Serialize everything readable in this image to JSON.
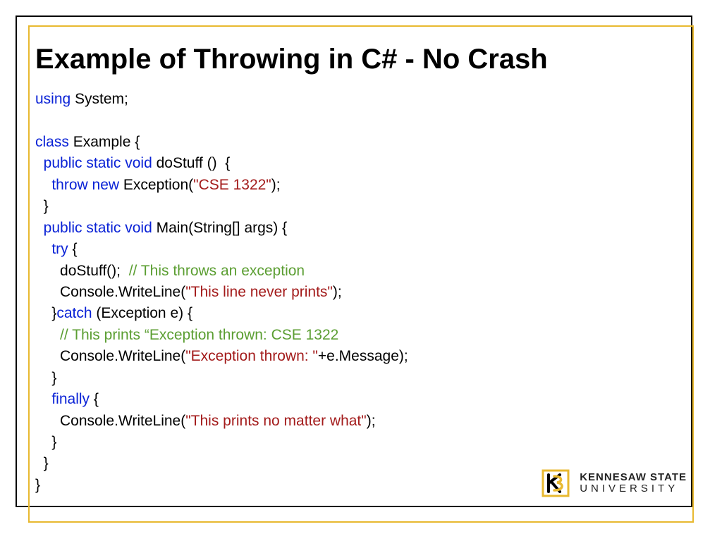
{
  "title": "Example of Throwing in C# - No Crash",
  "code": {
    "l1": {
      "kw1": "using",
      "t1": " System;"
    },
    "l2": {
      "kw1": "class",
      "t1": " Example {"
    },
    "l3": {
      "kw1": "public static void",
      "t1": " doStuff ()  {"
    },
    "l4": {
      "kw1": "throw new",
      "t1": " Exception(",
      "str1": "\"CSE 1322\"",
      "t2": ");"
    },
    "l5": {
      "t1": "}"
    },
    "l6": {
      "kw1": "public static void",
      "t1": " Main(String[] args) {"
    },
    "l7": {
      "kw1": "try",
      "t1": " {"
    },
    "l8": {
      "t1": "doStuff();  ",
      "cmt1": "// This throws an exception"
    },
    "l9": {
      "t1": "Console.WriteLine(",
      "str1": "\"This line never prints\"",
      "t2": ");"
    },
    "l10": {
      "t1": "}",
      "kw1": "catch",
      "t2": " (Exception e) {"
    },
    "l11": {
      "cmt1": "// This prints “Exception thrown: CSE 1322"
    },
    "l12": {
      "t1": "Console.WriteLine(",
      "str1": "\"Exception thrown: \"",
      "t2": "+e.Message);"
    },
    "l13": {
      "t1": "}"
    },
    "l14": {
      "kw1": "finally",
      "t1": " {"
    },
    "l15": {
      "t1": "Console.WriteLine(",
      "str1": "\"This prints no matter what\"",
      "t2": ");"
    },
    "l16": {
      "t1": "}"
    },
    "l17": {
      "t1": "}"
    },
    "l18": {
      "t1": "}"
    }
  },
  "logo": {
    "line1": "KENNESAW STATE",
    "line2": "UNIVERSITY"
  },
  "colors": {
    "keyword": "#0a22d6",
    "type": "#1494a9",
    "string": "#a31b1b",
    "comment": "#5b9e32",
    "accent": "#e8b930"
  }
}
